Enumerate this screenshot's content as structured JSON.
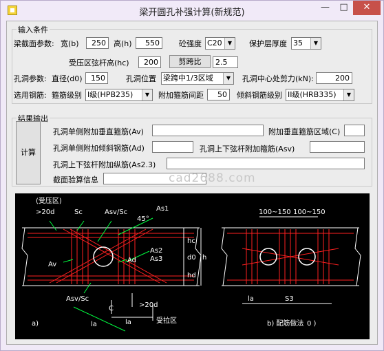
{
  "window": {
    "title": "梁开圆孔补强计算(新规范)",
    "min_glyph": "—",
    "max_glyph": "□",
    "close_glyph": "✕"
  },
  "input": {
    "legend": "输入条件",
    "section_label": "梁截面参数:",
    "width_label": "宽(b)",
    "width_value": "250",
    "height_label": "高(h)",
    "height_value": "550",
    "concrete_label": "砼强度",
    "concrete_value": "C20",
    "cover_label": "保护层厚度",
    "cover_value": "35",
    "chord_label": "受压区弦杆高(hc)",
    "chord_value": "200",
    "span_button": "剪跨比",
    "span_value": "2.5",
    "hole_label": "孔洞参数:",
    "diameter_label": "直径(d0)",
    "diameter_value": "150",
    "position_label": "孔洞位置",
    "position_value": "梁跨中1/3区域",
    "shear_label": "孔洞中心处剪力(kN):",
    "shear_value": "200",
    "rebar_label": "选用钢筋:",
    "stirrup_grade_label": "箍筋级别",
    "stirrup_grade_value": "I级(HPB235)",
    "extra_spacing_label": "附加箍筋间距",
    "extra_spacing_value": "50",
    "incline_grade_label": "倾斜钢筋级别",
    "incline_grade_value": "II级(HRB335)"
  },
  "output": {
    "legend": "结果输出",
    "calc_button": "计算",
    "av_label": "孔洞单侧附加垂直箍筋(Av)",
    "av_value": "",
    "c_label": "附加垂直箍筋区域(C)",
    "c_value": "",
    "ad_label": "孔洞单侧附加倾斜钢筋(Ad)",
    "ad_value": "",
    "asv_label": "孔洞上下弦杆附加箍筋(Asv)",
    "asv_value": "",
    "as23_label": "孔洞上下弦杆附加纵筋(As2.3)",
    "as23_value": "",
    "check_label": "截面验算信息",
    "check_value": ""
  },
  "diagram": {
    "watermark": "cad2688.com",
    "left_title": "(受压区)",
    "lbl_20d_top": ">20d",
    "lbl_sc": "Sc",
    "lbl_asv_sc_top": "Asv/Sc",
    "lbl_45": "45°",
    "lbl_as1": "As1",
    "lbl_as2": "As2",
    "lbl_as3": "As3",
    "lbl_av": "Av",
    "lbl_ad": "Ad",
    "lbl_asv_sc_bot": "Asv/Sc",
    "lbl_c": "C",
    "lbl_20d_bot": ">20d",
    "lbl_la1": "la",
    "lbl_la2": "la",
    "lbl_tension": "受拉区",
    "lbl_hc": "hc",
    "lbl_d0": "d0",
    "lbl_hd": "hd",
    "lbl_h": "h",
    "lbl_a": "a)",
    "lbl_dim1": "100~150",
    "lbl_dim2": "100~150",
    "lbl_la3": "la",
    "lbl_s3": "S3",
    "lbl_b": "b) 配筋做法",
    "lbl_b_tail": "0 )"
  }
}
